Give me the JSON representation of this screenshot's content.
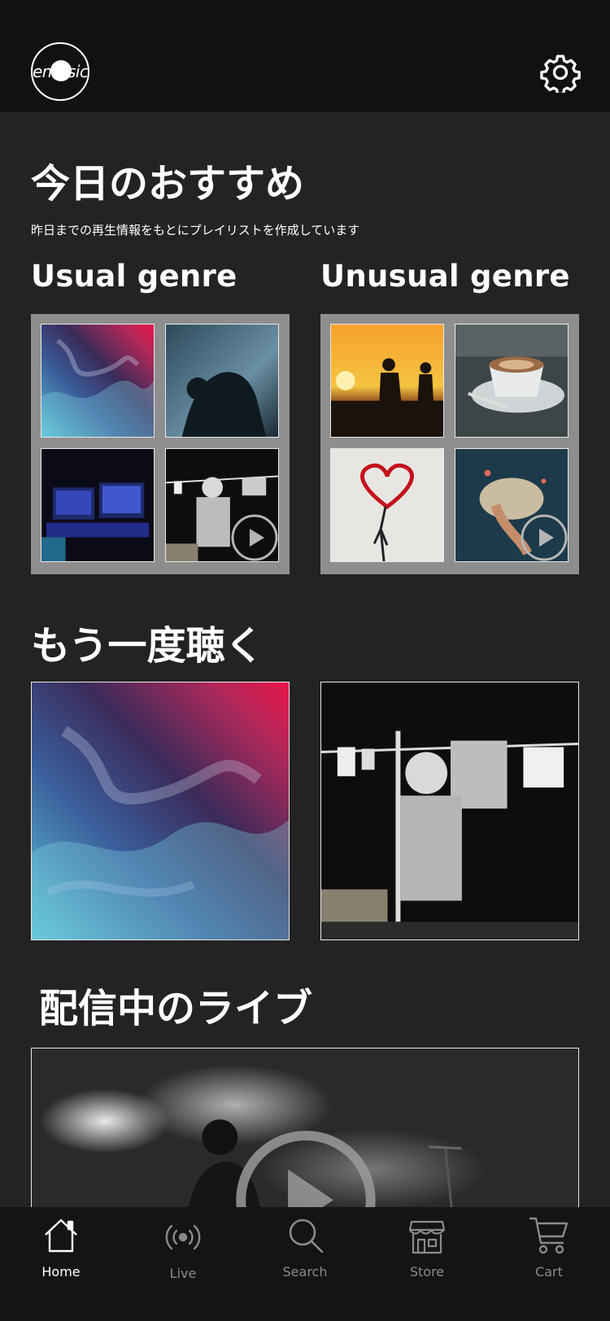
{
  "header": {
    "logo_text": "emusic",
    "settings_icon": "gear-icon"
  },
  "recommend": {
    "title": "今日のおすすめ",
    "subtitle": "昨日までの再生情報をもとにプレイリストを作成しています",
    "usual_title": "Usual genre",
    "unusual_title": "Unusual genre"
  },
  "listen_again": {
    "title": "もう一度聴く"
  },
  "live": {
    "title": "配信中のライブ"
  },
  "tabbar": {
    "items": [
      {
        "label": "Home",
        "icon": "home-icon",
        "active": true
      },
      {
        "label": "Live",
        "icon": "broadcast-icon",
        "active": false
      },
      {
        "label": "Search",
        "icon": "search-icon",
        "active": false
      },
      {
        "label": "Store",
        "icon": "store-icon",
        "active": false
      },
      {
        "label": "Cart",
        "icon": "cart-icon",
        "active": false
      }
    ]
  },
  "colors": {
    "background": "#232323",
    "header": "#111111",
    "tabbar": "#141414",
    "playlist_frame": "#8e8e8e",
    "inactive_tab": "#8a8a8a"
  }
}
